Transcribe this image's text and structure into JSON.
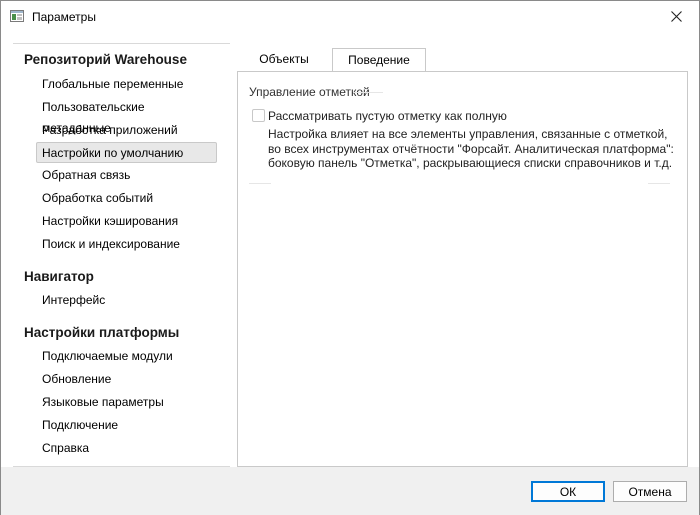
{
  "window": {
    "title": "Параметры"
  },
  "nav": {
    "sections": [
      {
        "title": "Репозиторий Warehouse",
        "items": [
          "Глобальные переменные",
          "Пользовательские метаданные",
          "Разработка приложений",
          "Настройки по умолчанию",
          "Обратная связь",
          "Обработка событий",
          "Настройки кэширования",
          "Поиск и индексирование"
        ]
      },
      {
        "title": "Навигатор",
        "items": [
          "Интерфейс"
        ]
      },
      {
        "title": "Настройки платформы",
        "items": [
          "Подключаемые модули",
          "Обновление",
          "Языковые параметры",
          "Подключение",
          "Справка"
        ]
      }
    ],
    "selected": "Настройки по умолчанию"
  },
  "tabs": [
    {
      "label": "Объекты",
      "active": false
    },
    {
      "label": "Поведение",
      "active": true
    }
  ],
  "panel": {
    "group_title": "Управление отметкой",
    "checkbox_label": "Рассматривать пустую отметку как полную",
    "checkbox_checked": false,
    "description": "Настройка влияет на все элементы управления, связанные с отметкой, во всех инструментах отчётности \"Форсайт. Аналитическая платформа\": боковую панель \"Отметка\", раскрывающиеся списки справочников и т.д."
  },
  "buttons": {
    "ok": "ОК",
    "cancel": "Отмена"
  },
  "colors": {
    "accent": "#0078d7",
    "selected_bg": "#e8e8e8",
    "footer_bg": "#f0f0f0"
  }
}
